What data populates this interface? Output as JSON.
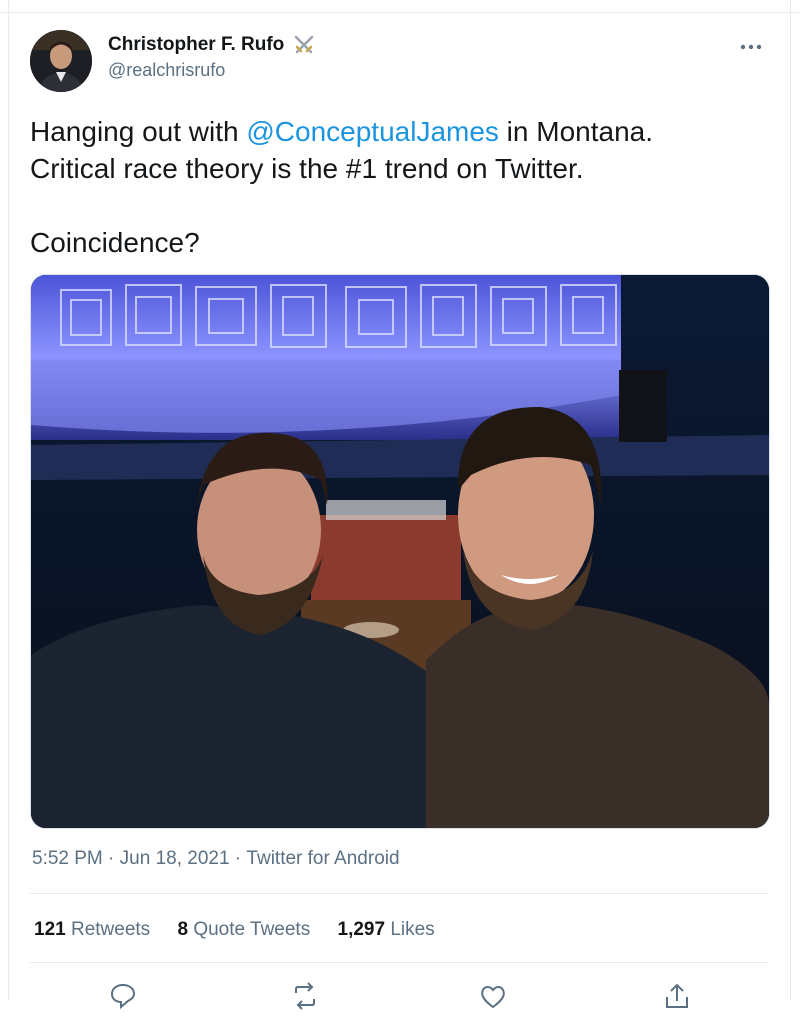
{
  "author": {
    "display_name": "Christopher F. Rufo",
    "handle": "@realchrisrufo",
    "badge_icon": "crossed-swords-icon"
  },
  "more_icon": "more-options-icon",
  "tweet": {
    "line1_prefix": "Hanging out with ",
    "mention": "@ConceptualJames",
    "line1_suffix": " in Montana.",
    "line2": "Critical race theory is the #1 trend on Twitter.",
    "line3": "Coincidence?"
  },
  "meta": {
    "time": "5:52 PM",
    "sep1": " · ",
    "date": "Jun 18, 2021",
    "sep2": " · ",
    "source": "Twitter for Android"
  },
  "stats": {
    "retweets_count": "121",
    "retweets_label": "Retweets",
    "quotes_count": "8",
    "quotes_label": "Quote Tweets",
    "likes_count": "1,297",
    "likes_label": "Likes"
  },
  "actions": [
    "reply-icon",
    "retweet-icon",
    "like-icon",
    "share-icon"
  ],
  "colors": {
    "link": "#1b95e0",
    "secondary_text": "#5b7083",
    "primary_text": "#14171a",
    "divider": "#e6ecf0"
  }
}
